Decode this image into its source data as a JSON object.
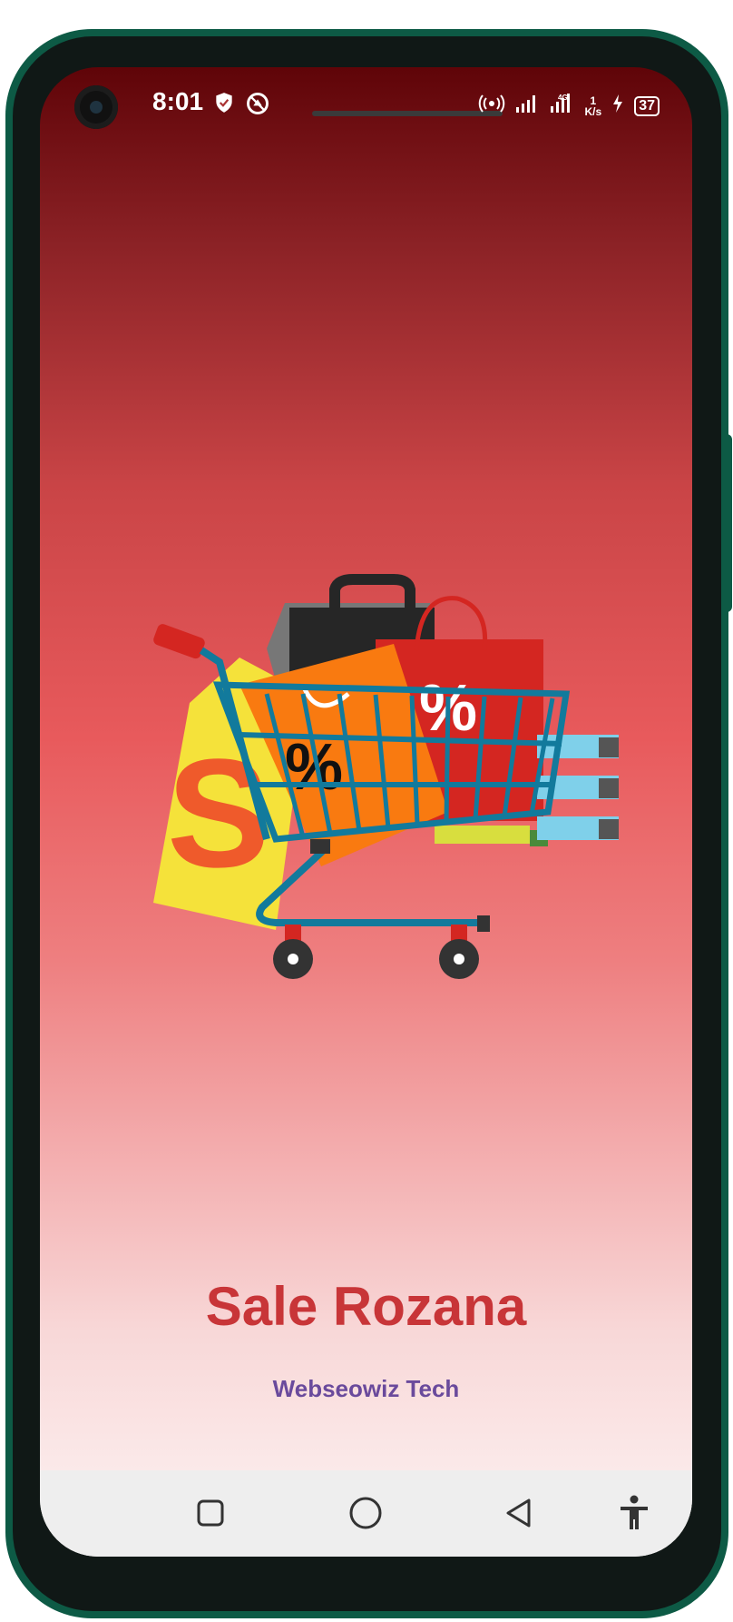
{
  "status_bar": {
    "time": "8:01",
    "left_icons": [
      "shield-icon",
      "data-saver-icon"
    ],
    "right_icons": [
      "hotspot-icon",
      "signal-icon",
      "signal-4g-icon"
    ],
    "network_speed_value": "1",
    "network_speed_unit": "K/s",
    "battery_level": "37"
  },
  "app": {
    "title": "Sale Rozana",
    "company": "Webseowiz Tech",
    "illustration": "shopping-cart-sale-icon",
    "colors": {
      "title": "#c83538",
      "company": "#6a4a9c"
    }
  },
  "nav_bar": {
    "buttons": [
      "recents-square-icon",
      "home-circle-icon",
      "back-triangle-icon",
      "accessibility-icon"
    ]
  }
}
